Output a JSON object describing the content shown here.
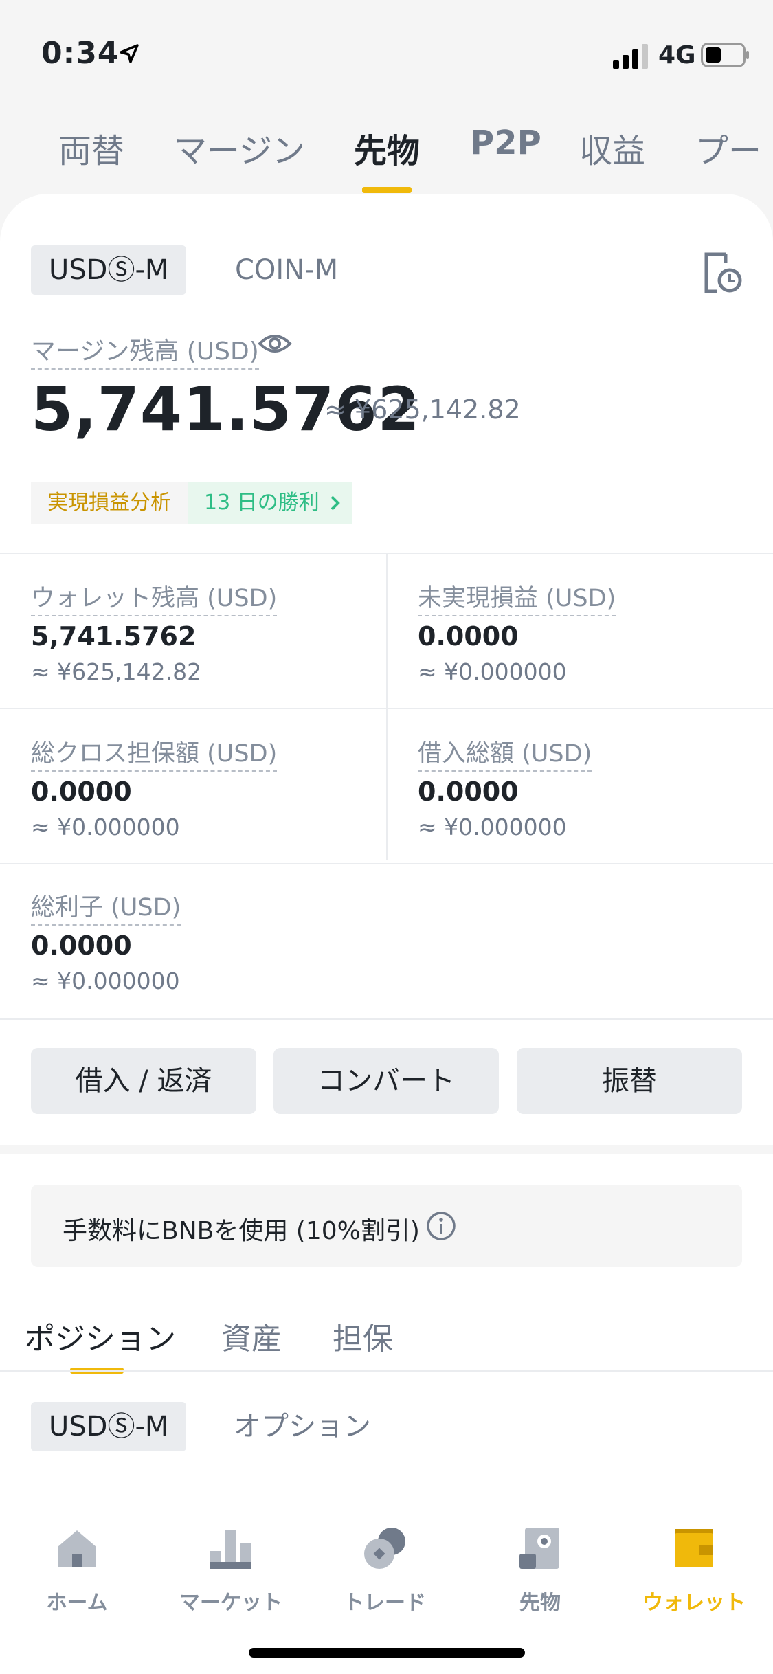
{
  "status_bar": {
    "time": "0:34",
    "network": "4G"
  },
  "top_tabs": [
    {
      "label": "両替"
    },
    {
      "label": "マージン"
    },
    {
      "label": "先物"
    },
    {
      "label": "P2P"
    },
    {
      "label": "収益"
    },
    {
      "label": "プー"
    }
  ],
  "contract_tabs": {
    "usds_m": "USDⓈ-M",
    "coin_m": "COIN-M"
  },
  "margin_balance": {
    "label": "マージン残高 (USD)",
    "value": "5,741.5762",
    "approx": "≈ ¥625,142.82"
  },
  "pnl": {
    "analysis_label": "実現損益分析",
    "win_label": "13 日の勝利"
  },
  "stats": {
    "wallet": {
      "label": "ウォレット残高 (USD)",
      "value": "5,741.5762",
      "approx": "≈ ¥625,142.82"
    },
    "unrealized": {
      "label": "未実現損益 (USD)",
      "value": "0.0000",
      "approx": "≈ ¥0.000000"
    },
    "cross_collateral": {
      "label": "総クロス担保額 (USD)",
      "value": "0.0000",
      "approx": "≈ ¥0.000000"
    },
    "borrowed": {
      "label": "借入総額 (USD)",
      "value": "0.0000",
      "approx": "≈ ¥0.000000"
    },
    "interest": {
      "label": "総利子 (USD)",
      "value": "0.0000",
      "approx": "≈ ¥0.000000"
    }
  },
  "actions": {
    "borrow_repay": "借入 / 返済",
    "convert": "コンバート",
    "transfer": "振替"
  },
  "bnb_fee": {
    "label": "手数料にBNBを使用 (10%割引)"
  },
  "position_tabs": [
    {
      "label": "ポジション"
    },
    {
      "label": "資産"
    },
    {
      "label": "担保"
    }
  ],
  "sub_tabs": {
    "usds_m": "USDⓈ-M",
    "option": "オプション"
  },
  "bottom_nav": [
    {
      "label": "ホーム"
    },
    {
      "label": "マーケット"
    },
    {
      "label": "トレード"
    },
    {
      "label": "先物"
    },
    {
      "label": "ウォレット"
    }
  ],
  "colors": {
    "accent": "#f0b90b",
    "positive": "#2ebd85",
    "text": "#1e2329",
    "muted": "#848e9c"
  }
}
